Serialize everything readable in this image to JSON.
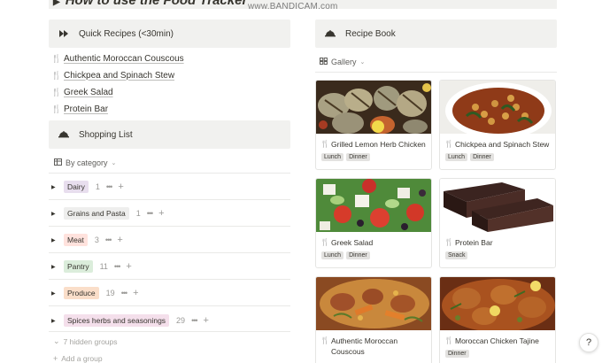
{
  "page": {
    "heading": "How to use the Food Tracker",
    "watermark": "www.BANDICAM.com"
  },
  "quick_recipes": {
    "title": "Quick Recipes (<30min)",
    "icon": "fast-forward-icon",
    "items": [
      {
        "label": "Authentic Moroccan Couscous",
        "icon": "fork-knife-icon"
      },
      {
        "label": "Chickpea and Spinach Stew",
        "icon": "fork-knife-icon"
      },
      {
        "label": "Greek Salad",
        "icon": "fork-knife-icon"
      },
      {
        "label": "Protein Bar",
        "icon": "fork-knife-icon"
      }
    ]
  },
  "shopping_list": {
    "title": "Shopping List",
    "icon": "serving-dish-icon",
    "view_label": "By category",
    "groups": [
      {
        "label": "Dairy",
        "count": "1",
        "color": "#e8deee"
      },
      {
        "label": "Grains and Pasta",
        "count": "1",
        "color": "#eeeeed"
      },
      {
        "label": "Meat",
        "count": "3",
        "color": "#ffe2dd"
      },
      {
        "label": "Pantry",
        "count": "11",
        "color": "#dbeddb"
      },
      {
        "label": "Produce",
        "count": "19",
        "color": "#fadec9"
      },
      {
        "label": "Spices herbs and seasonings",
        "count": "29",
        "color": "#f4dfeb"
      }
    ],
    "hidden_groups": "7 hidden groups",
    "add_group": "Add a group"
  },
  "recipe_book": {
    "title": "Recipe Book",
    "icon": "serving-dish-icon",
    "view_label": "Gallery",
    "cards": [
      {
        "title": "Grilled Lemon Herb Chicken",
        "tags": [
          "Lunch",
          "Dinner"
        ]
      },
      {
        "title": "Chickpea and Spinach Stew",
        "tags": [
          "Lunch",
          "Dinner"
        ]
      },
      {
        "title": "Greek Salad",
        "tags": [
          "Lunch",
          "Dinner"
        ]
      },
      {
        "title": "Protein Bar",
        "tags": [
          "Snack"
        ]
      },
      {
        "title": "Authentic Moroccan Couscous",
        "tags": []
      },
      {
        "title": "Moroccan Chicken Tajine",
        "tags": [
          "Dinner"
        ]
      }
    ]
  },
  "help": {
    "label": "?"
  }
}
